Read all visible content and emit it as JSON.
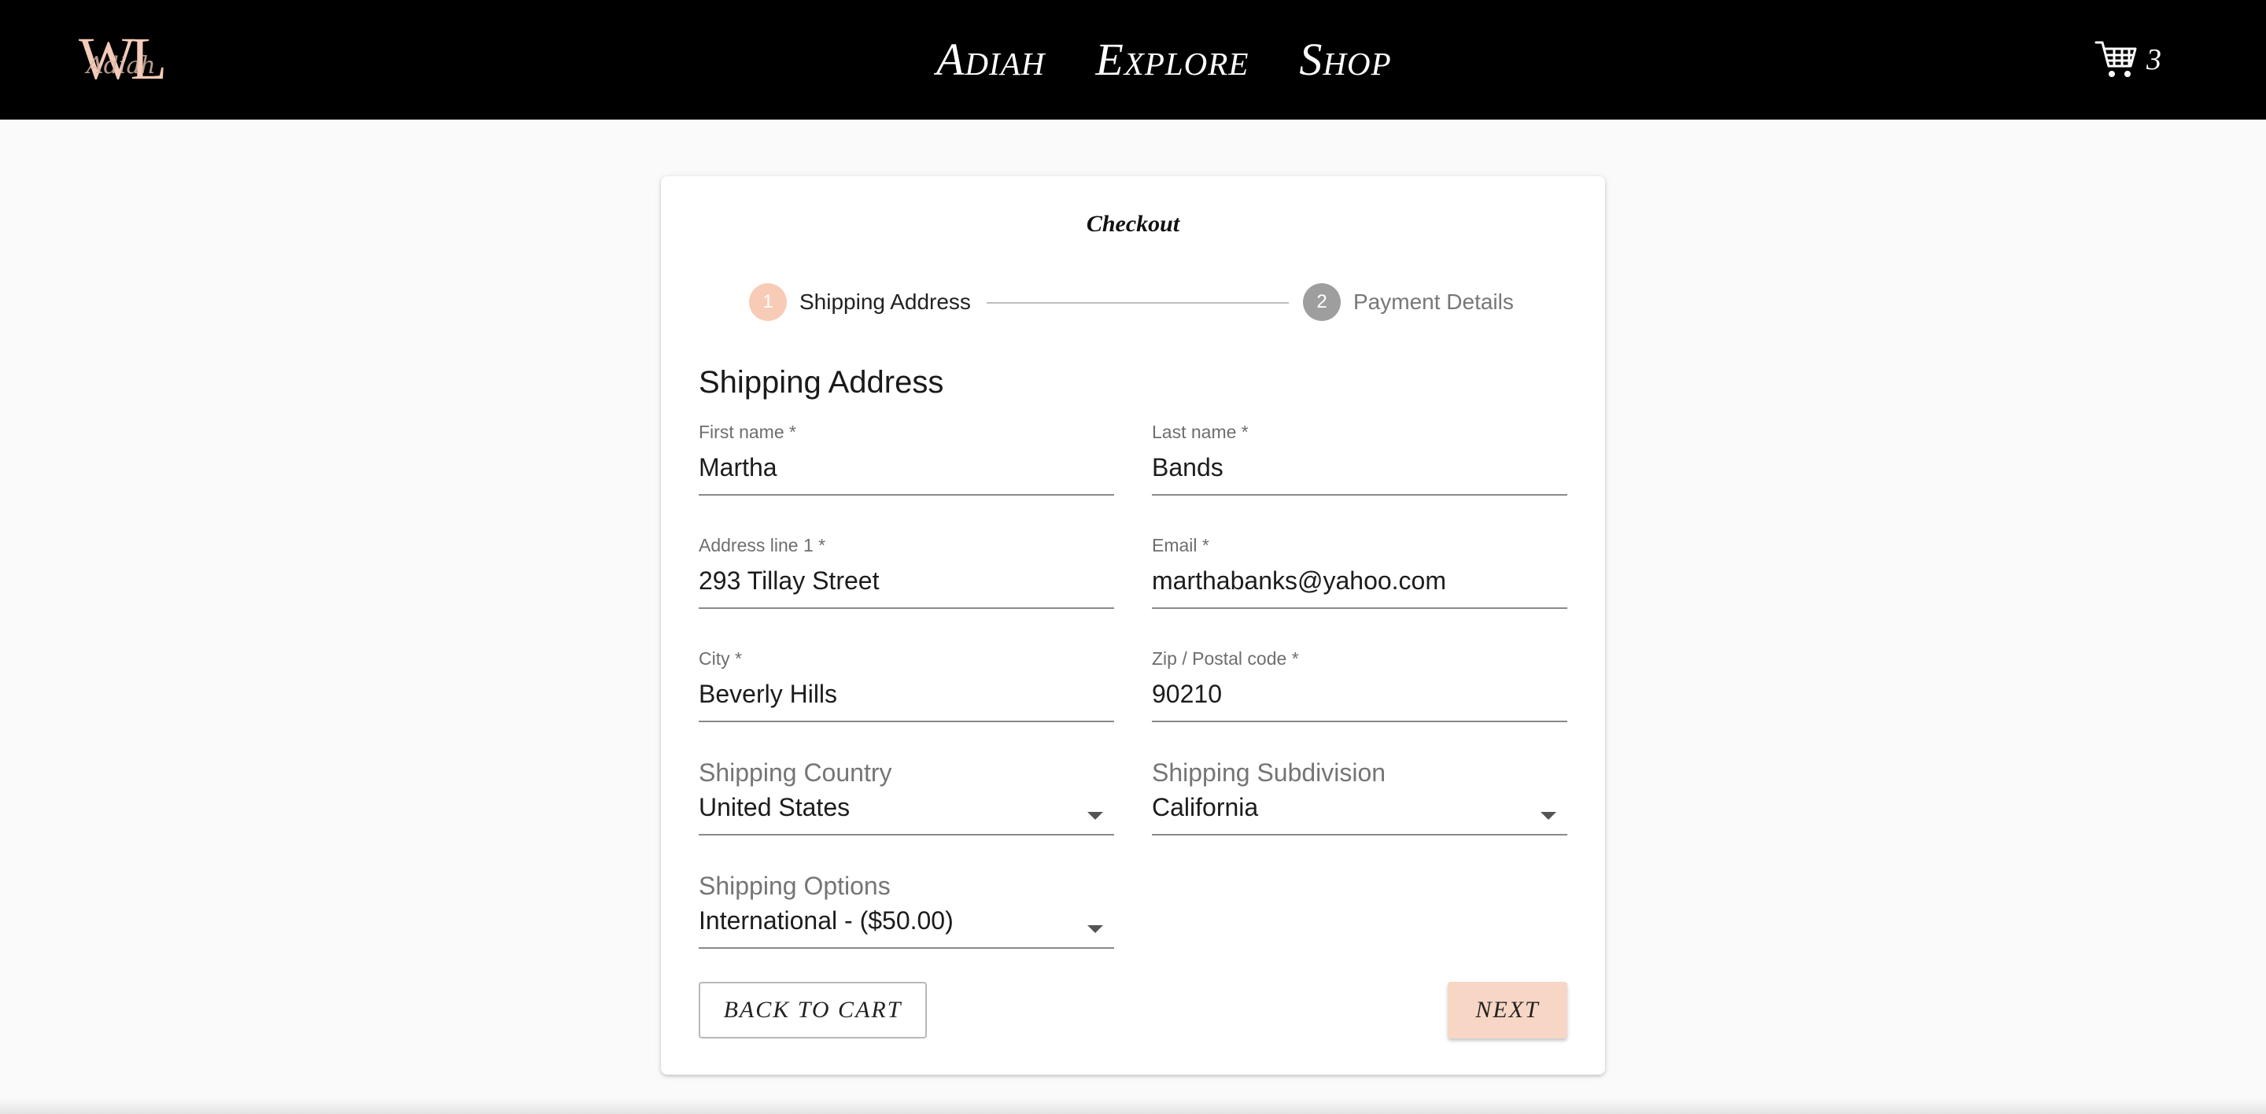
{
  "header": {
    "logo_letters": "WL",
    "logo_script": "Adiah",
    "nav": [
      "Adiah",
      "Explore",
      "Shop"
    ],
    "cart_count": "3"
  },
  "checkout": {
    "title": "Checkout",
    "steps": [
      {
        "number": "1",
        "label": "Shipping Address"
      },
      {
        "number": "2",
        "label": "Payment Details"
      }
    ],
    "section_title": "Shipping Address",
    "fields": {
      "first_name": {
        "label": "First name *",
        "value": "Martha"
      },
      "last_name": {
        "label": "Last name *",
        "value": "Bands"
      },
      "address1": {
        "label": "Address line 1 *",
        "value": "293 Tillay Street"
      },
      "email": {
        "label": "Email *",
        "value": "marthabanks@yahoo.com"
      },
      "city": {
        "label": "City *",
        "value": "Beverly Hills"
      },
      "zip": {
        "label": "Zip / Postal code *",
        "value": "90210"
      }
    },
    "selects": {
      "country": {
        "label": "Shipping Country",
        "value": "United States"
      },
      "subdivision": {
        "label": "Shipping Subdivision",
        "value": "California"
      },
      "options": {
        "label": "Shipping Options",
        "value": "International - ($50.00)"
      }
    },
    "buttons": {
      "back": "BACK TO CART",
      "next": "NEXT"
    }
  },
  "colors": {
    "accent": "#f8cbb7",
    "header_bg": "#000000",
    "inactive_step": "#9e9e9e"
  }
}
